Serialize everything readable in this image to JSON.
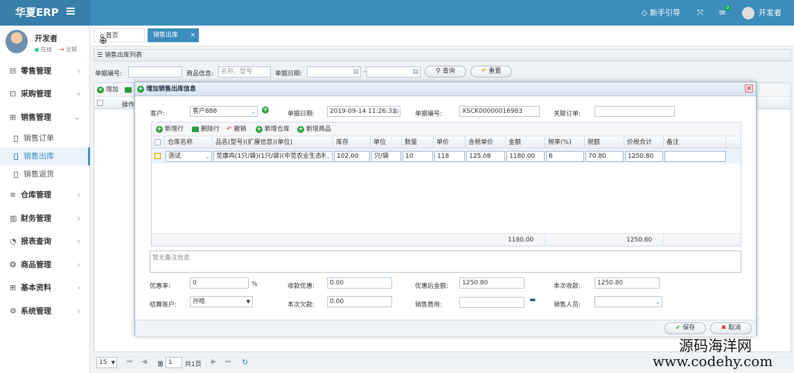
{
  "app": {
    "brand": "华夏ERP"
  },
  "topbar": {
    "guide": "新手引导",
    "mail_badge": "0",
    "user": "开发者"
  },
  "sidebar": {
    "user_name": "开发者",
    "status_online": "在线",
    "logout": "注销",
    "menus": [
      {
        "label": "零售管理",
        "icon": "⊟"
      },
      {
        "label": "采购管理",
        "icon": "⊡"
      },
      {
        "label": "销售管理",
        "icon": "⊞"
      },
      {
        "label": "仓库管理",
        "icon": "≋"
      },
      {
        "label": "财务管理",
        "icon": "▥"
      },
      {
        "label": "报表查询",
        "icon": "◔"
      },
      {
        "label": "商品管理",
        "icon": "❂"
      },
      {
        "label": "基本资料",
        "icon": "⊞"
      },
      {
        "label": "系统管理",
        "icon": "⚙"
      }
    ],
    "sales_sub": [
      "销售订单",
      "销售出库",
      "销售退货"
    ]
  },
  "tabs": {
    "home": "首页",
    "current": "销售出库"
  },
  "list": {
    "title": "销售出库列表",
    "search": {
      "doc_no_label": "单据编号:",
      "goods_label": "商品信息:",
      "goods_placeholder": "名称、型号",
      "date_label": "单据日期:",
      "date_sep": "-",
      "query_btn": "查询",
      "reset_btn": "重置"
    },
    "toolbar": {
      "add": "增加"
    },
    "grid_header": {
      "op": "操作"
    },
    "pager": {
      "page_size": "15",
      "page_prefix": "第",
      "page_no": "1",
      "total": "共1页"
    }
  },
  "modal": {
    "title": "增加销售出库信息",
    "customer_label": "客户:",
    "customer_value": "客户888",
    "date_label": "单据日期:",
    "date_value": "2019-09-14 11:26:33",
    "doc_no_label": "单据编号:",
    "doc_no_value": "XSCK00000016983",
    "link_order_label": "关联订单:",
    "link_order_value": "",
    "grid_toolbar": {
      "add_row": "新增行",
      "del_row": "删除行",
      "undo": "撤销",
      "add_wh": "新增仓库",
      "add_goods": "新增商品"
    },
    "columns": [
      "仓库名称",
      "品名(型号)(扩展信息)(单位)",
      "库存",
      "单位",
      "数量",
      "单价",
      "含税单价",
      "金额",
      "税率(%)",
      "税额",
      "价税合计",
      "备注"
    ],
    "row": {
      "warehouse": "测试",
      "goods": "苋康鸡(1只/袋)(1只/袋)(中苋农业生态科",
      "stock": "102.00",
      "unit": "只/袋",
      "qty": "10",
      "price": "118",
      "tax_price": "125.08",
      "amount": "1180.00",
      "tax_rate": "6",
      "tax": "70.80",
      "total": "1250.80",
      "remark": ""
    },
    "footer_sum": {
      "amount": "1180.00",
      "total": "1250.80"
    },
    "remark_placeholder": "暂无备注信息",
    "discount_rate_label": "优惠率:",
    "discount_rate_value": "0",
    "percent": "%",
    "discount_label": "收款优惠:",
    "discount_value": "0.00",
    "after_discount_label": "优惠后金额:",
    "after_discount_value": "1250.80",
    "receive_label": "本次收款:",
    "receive_value": "1250.80",
    "account_label": "结算账户:",
    "account_value": "孙哈",
    "debt_label": "本次欠款:",
    "debt_value": "0.00",
    "fee_label": "销售费用:",
    "fee_value": "",
    "salesman_label": "销售人员:",
    "salesman_value": "",
    "save_btn": "保存",
    "cancel_btn": "取消"
  },
  "watermark": {
    "line1": "源码海洋网",
    "line2": "www.codehy.com"
  }
}
